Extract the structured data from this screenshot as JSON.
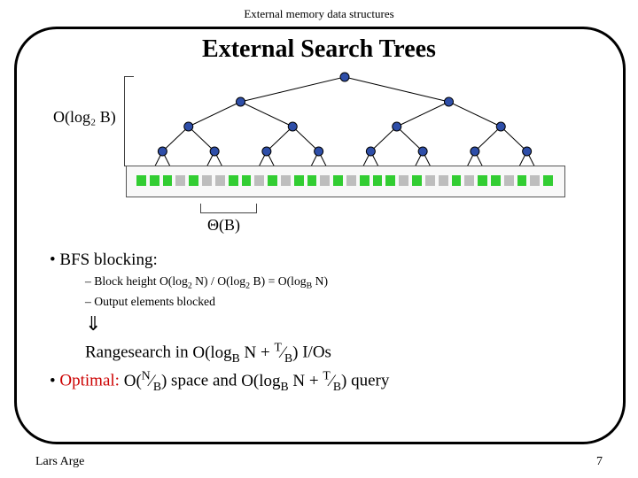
{
  "header": {
    "text": "External memory data structures"
  },
  "title": "External Search Trees",
  "math": {
    "log2B": "O(log₂ B)",
    "thetaB": "Θ(B)",
    "block_height_eq": "O(log₂ N) / O(log₂ B) = O(log_B N)",
    "rangesearch_io": "O(log_B N + T⁄B)",
    "space": "O(N⁄B)",
    "query": "O(log_B N + T⁄B)"
  },
  "bullets": {
    "bfs": "BFS blocking:",
    "block_height": "Block height",
    "output_blocked": "Output elements blocked",
    "arrow": "⇓",
    "rangesearch_prefix": "Rangesearch in ",
    "rangesearch_suffix": " I/Os",
    "optimal_label": "Optimal:",
    "optimal_mid": " space and ",
    "optimal_end": " query"
  },
  "footer": {
    "author": "Lars Arge",
    "page": "7"
  },
  "colors": {
    "leaf_colors": [
      "#32cd32",
      "#32cd32",
      "#32cd32",
      "#bdbdbd",
      "#32cd32",
      "#bdbdbd",
      "#bdbdbd",
      "#32cd32",
      "#32cd32",
      "#bdbdbd",
      "#32cd32",
      "#bdbdbd",
      "#32cd32",
      "#32cd32",
      "#bdbdbd",
      "#32cd32",
      "#bdbdbd",
      "#32cd32",
      "#32cd32",
      "#32cd32",
      "#bdbdbd",
      "#32cd32",
      "#bdbdbd",
      "#bdbdbd",
      "#32cd32",
      "#bdbdbd",
      "#32cd32",
      "#32cd32",
      "#bdbdbd",
      "#32cd32",
      "#bdbdbd",
      "#32cd32"
    ],
    "node_fill": "#2e4ea8",
    "node_stroke": "#000"
  }
}
